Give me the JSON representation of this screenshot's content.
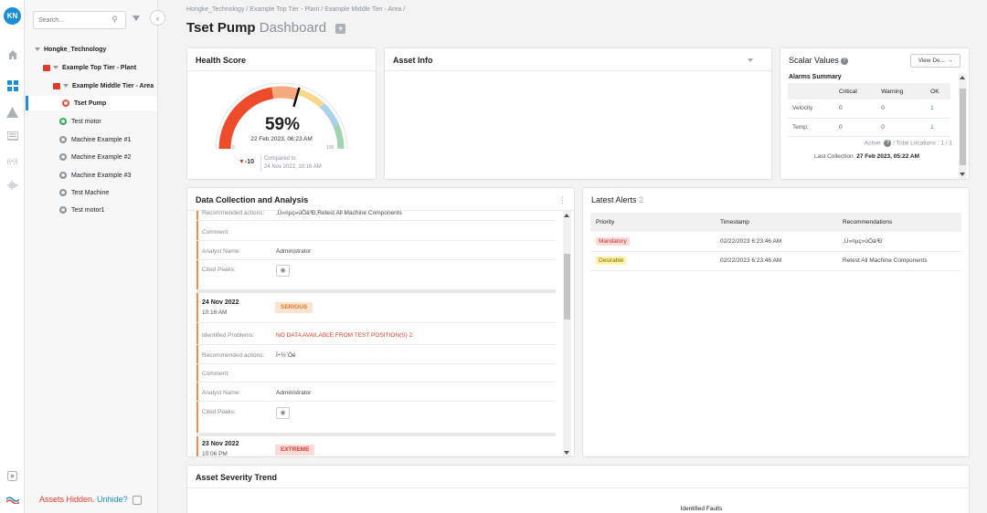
{
  "user": {
    "initials": "KN"
  },
  "sidebar": {
    "search_placeholder": "Search...",
    "tree": [
      {
        "label": "Hongke_Technology"
      },
      {
        "label": "Example Top Tier - Plant"
      },
      {
        "label": "Example Middle Tier - Area"
      },
      {
        "label": "Tset Pump"
      },
      {
        "label": "Test motor"
      },
      {
        "label": "Machine Example #1"
      },
      {
        "label": "Machine Example #2"
      },
      {
        "label": "Machine Example #3"
      },
      {
        "label": "Test Machine"
      },
      {
        "label": "Test motor1"
      }
    ],
    "assets_hidden": "Assets Hidden.",
    "unhide": "Unhide?"
  },
  "header": {
    "breadcrumb": "Hongke_Technology / Example Top Tier - Plant / Example Middle Tier - Area /",
    "asset_name": "Tset Pump",
    "dashboard_label": "Dashboard"
  },
  "health": {
    "title": "Health Score",
    "percent": "59%",
    "score": 59,
    "date": "22 Feb 2023, 06:23 AM",
    "min_label": "0",
    "max_label": "100",
    "delta": "-10",
    "compared_label": "Compared to",
    "compared_date": "24 Nov 2022, 10:16 AM"
  },
  "asset_info": {
    "title": "Asset Info"
  },
  "scalar": {
    "title": "Scalar Values",
    "view_button": "View De...",
    "alarms_title": "Alarms Summary",
    "columns": [
      "",
      "Critical",
      "Warning",
      "OK"
    ],
    "rows": [
      {
        "name": "Velocity",
        "critical": "0",
        "warning": "0",
        "ok": "1"
      },
      {
        "name": "Temp.",
        "critical": "0",
        "warning": "0",
        "ok": "1"
      }
    ],
    "active_label": "Active",
    "total_locations": "/ Total Locations : 1 / 1",
    "last_collection_label": "Last Collection",
    "last_collection_value": "27 Feb 2023, 05:22 AM"
  },
  "data_collection": {
    "title": "Data Collection and Analysis",
    "labels": {
      "recommended": "Recommended actions:",
      "comment": "Comment:",
      "analyst": "Analyst Name:",
      "cited": "Cited Peaks:",
      "identified": "Identified Problems:"
    },
    "entry0": {
      "recommended": ",Ù»¤µç»úÖá³Ð,Retest All Machine Components",
      "analyst": "Administrator"
    },
    "entry1": {
      "date": "24 Nov 2022",
      "time": "10:16 AM",
      "severity": "SERIOUS",
      "identified": "NO DATA AVAILABLE FROM TEST POSITION(S) 2.",
      "recommended": "Í÷½¨Òé",
      "analyst": "Administrator"
    },
    "entry2": {
      "date": "23 Nov 2022",
      "time": "10:06 PM",
      "severity": "EXTREME"
    }
  },
  "alerts": {
    "title": "Latest Alerts",
    "count": "2",
    "columns": [
      "Priority",
      "Timestamp",
      "Recommendations"
    ],
    "rows": [
      {
        "priority": "Mandatory",
        "timestamp": "02/22/2023 6:23:46 AM",
        "recommendation": ",Ù»¤µç»úÖá³Ð"
      },
      {
        "priority": "Desirable",
        "timestamp": "02/22/2023 6:23:46 AM",
        "recommendation": "Retest All Machine Components"
      }
    ]
  },
  "trend": {
    "title": "Asset Severity Trend",
    "subtitle": "Identified Faults"
  },
  "colors": {
    "accent": "#1a8fd6",
    "danger": "#e23b2a",
    "serious": "#f08c45"
  }
}
